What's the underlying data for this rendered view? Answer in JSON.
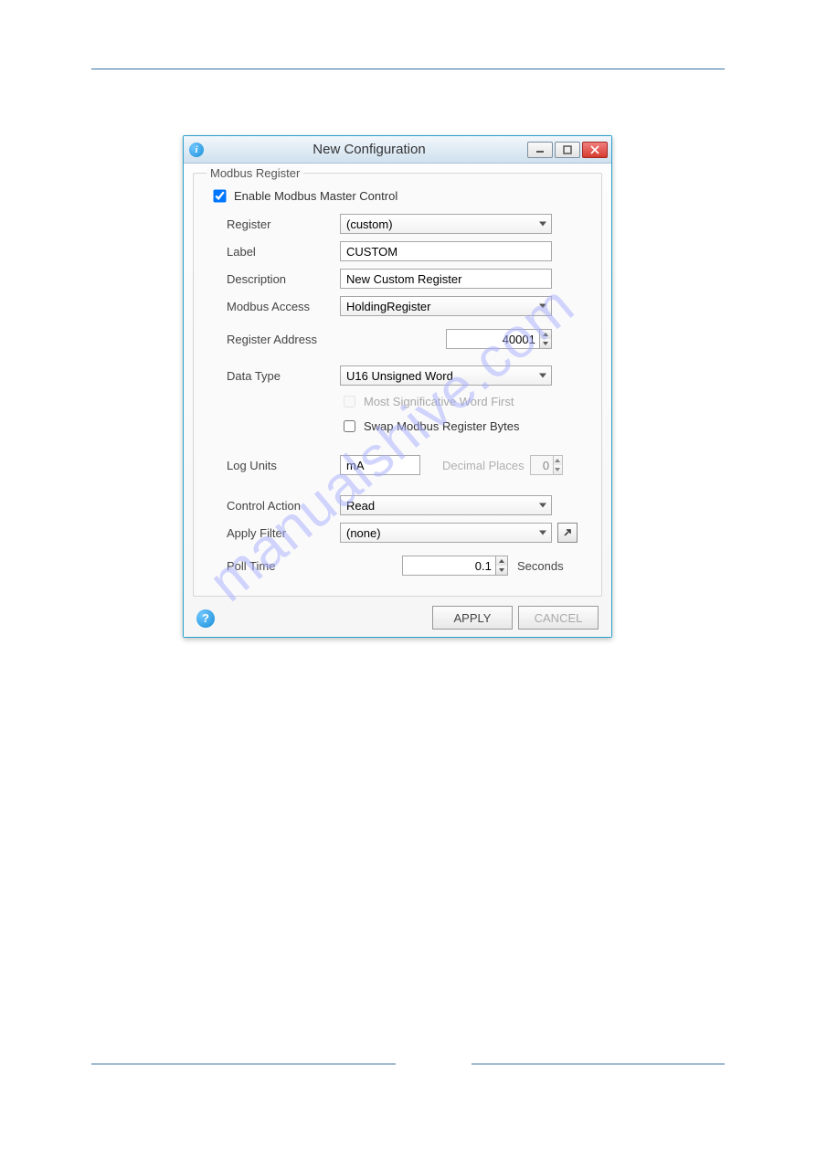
{
  "window": {
    "title": "New Configuration"
  },
  "groupbox": {
    "legend": "Modbus Register",
    "enable_checkbox_label": "Enable Modbus Master Control",
    "enabled": true
  },
  "fields": {
    "register": {
      "label": "Register",
      "value": "(custom)"
    },
    "label": {
      "label": "Label",
      "value": "CUSTOM"
    },
    "description": {
      "label": "Description",
      "value": "New Custom Register"
    },
    "modbus_access": {
      "label": "Modbus Access",
      "value": "HoldingRegister"
    },
    "register_address": {
      "label": "Register Address",
      "value": "40001"
    },
    "data_type": {
      "label": "Data Type",
      "value": "U16 Unsigned Word"
    },
    "msw_first": {
      "label": "Most Significative Word First",
      "checked": false
    },
    "swap_bytes": {
      "label": "Swap Modbus Register Bytes",
      "checked": false
    },
    "log_units": {
      "label": "Log Units",
      "value": "mA"
    },
    "decimal_places": {
      "label": "Decimal Places",
      "value": "0"
    },
    "control_action": {
      "label": "Control Action",
      "value": "Read"
    },
    "apply_filter": {
      "label": "Apply Filter",
      "value": "(none)"
    },
    "poll_time": {
      "label": "Poll Time",
      "value": "0.1",
      "unit": "Seconds"
    }
  },
  "buttons": {
    "apply": "APPLY",
    "cancel": "CANCEL",
    "help": "?"
  },
  "watermark": "manualshive.com"
}
